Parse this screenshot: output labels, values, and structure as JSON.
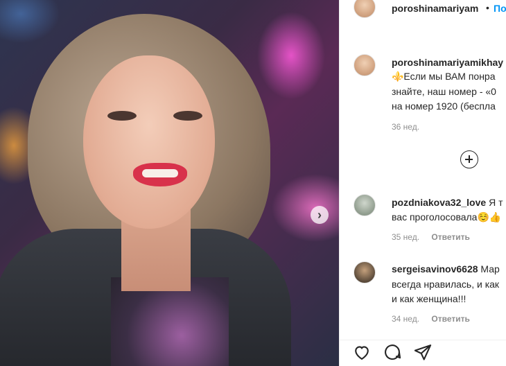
{
  "post_author": "poroshinamariyam",
  "follow_label": "По",
  "dot": "•",
  "caption": {
    "username": "poroshinamariyamikhay",
    "line1": "⚜️Если мы ВАМ понра",
    "line2": "знайте, наш номер - «0",
    "line3": "на номер 1920 (беспла",
    "time": "36 нед."
  },
  "comments": [
    {
      "username": "pozdniakova32_love",
      "text_inline": "Я т",
      "line2": "вас проголосовала☺️👍",
      "time": "35 нед.",
      "reply": "Ответить"
    },
    {
      "username": "sergeisavinov6628",
      "text_inline": "Мар",
      "line2": "всегда нравилась, и как",
      "line3": "и как женщина!!!",
      "time": "34 нед.",
      "reply": "Ответить"
    }
  ],
  "icons": {
    "next": "chevron-right-icon",
    "more": "plus-circle-icon",
    "like": "heart-icon",
    "comment": "comment-icon",
    "share": "send-icon"
  },
  "colors": {
    "link": "#0095f6",
    "meta": "#8e8e8e",
    "text": "#262626"
  }
}
